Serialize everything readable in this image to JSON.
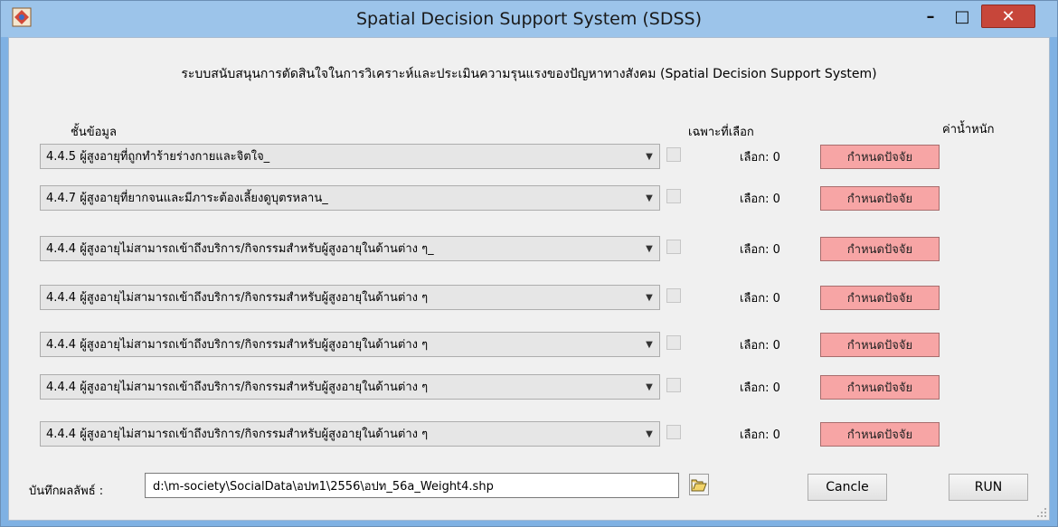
{
  "window": {
    "title": "Spatial Decision Support System (SDSS)",
    "close_symbol": "✕",
    "min_symbol": "–",
    "max_symbol": "□"
  },
  "heading": "ระบบสนับสนุนการตัดสินใจในการวิเคราะห์และประเมินความรุนแรงของปัญหาทางสังคม (Spatial Decision Support System)",
  "columns": {
    "layer": "ชั้นข้อมูล",
    "selected_only": "เฉพาะที่เลือก",
    "weight": "ค่าน้ำหนัก"
  },
  "rows": [
    {
      "layer": "4.4.5 ผู้สูงอายุที่ถูกทำร้ายร่างกายและจิตใจ_",
      "selected": "เลือก: 0",
      "button": "กำหนดปัจจัย"
    },
    {
      "layer": "4.4.7 ผู้สูงอายุที่ยากจนและมีภาระต้องเลี้ยงดูบุตรหลาน_",
      "selected": "เลือก: 0",
      "button": "กำหนดปัจจัย"
    },
    {
      "layer": "4.4.4 ผู้สูงอายุไม่สามารถเข้าถึงบริการ/กิจกรรมสำหรับผู้สูงอายุในด้านต่าง ๆ_",
      "selected": "เลือก: 0",
      "button": "กำหนดปัจจัย"
    },
    {
      "layer": "4.4.4 ผู้สูงอายุไม่สามารถเข้าถึงบริการ/กิจกรรมสำหรับผู้สูงอายุในด้านต่าง ๆ",
      "selected": "เลือก: 0",
      "button": "กำหนดปัจจัย"
    },
    {
      "layer": "4.4.4 ผู้สูงอายุไม่สามารถเข้าถึงบริการ/กิจกรรมสำหรับผู้สูงอายุในด้านต่าง ๆ",
      "selected": "เลือก: 0",
      "button": "กำหนดปัจจัย"
    },
    {
      "layer": "4.4.4 ผู้สูงอายุไม่สามารถเข้าถึงบริการ/กิจกรรมสำหรับผู้สูงอายุในด้านต่าง ๆ",
      "selected": "เลือก: 0",
      "button": "กำหนดปัจจัย"
    },
    {
      "layer": "4.4.4 ผู้สูงอายุไม่สามารถเข้าถึงบริการ/กิจกรรมสำหรับผู้สูงอายุในด้านต่าง ๆ",
      "selected": "เลือก: 0",
      "button": "กำหนดปัจจัย"
    }
  ],
  "footer": {
    "save_label": "บันทึกผลลัพธ์ :",
    "path_value": "d:\\m-society\\SocialData\\อปท1\\2556\\อปท_56a_Weight4.shp",
    "cancel_label": "Cancle",
    "run_label": "RUN"
  },
  "colors": {
    "titlebar": "#9cc4ea",
    "factor_button": "#f7a5a5",
    "close_button": "#c7463a"
  },
  "icons": {
    "app": "app-logo-icon",
    "folder": "open-folder-icon",
    "dropdown": "chevron-down-icon"
  }
}
